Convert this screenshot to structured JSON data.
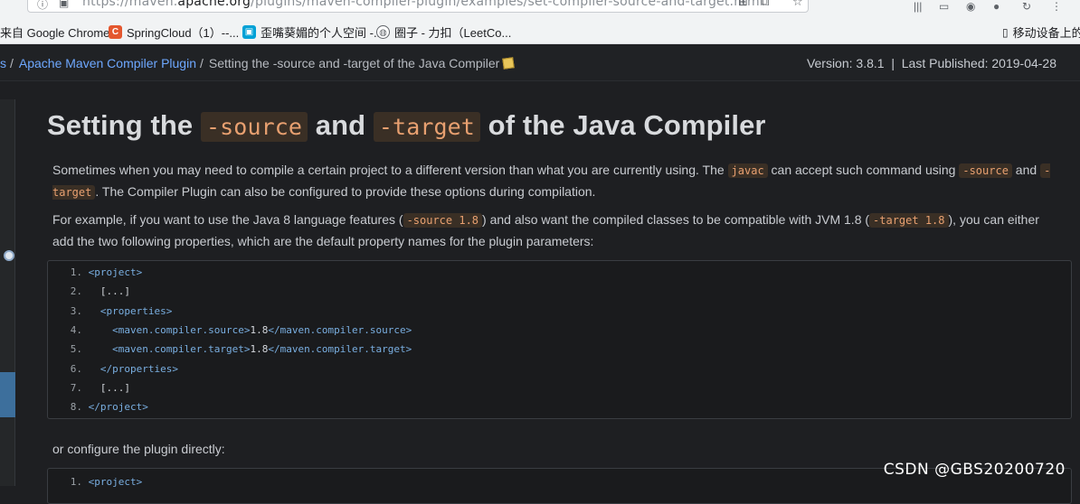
{
  "browser": {
    "url_prefix": "https://maven.",
    "url_host": "apache.org",
    "url_path": "/plugins/maven-compiler-plugin/examples/set-compiler-source-and-target.html",
    "bookmarks": [
      {
        "label": "来自 Google Chrome",
        "icon": "none"
      },
      {
        "label": "SpringCloud（1）--...",
        "icon": "c-logo-icon",
        "color": "#e4572e"
      },
      {
        "label": "歪嘴葵媚的个人空间 -...",
        "icon": "tv-icon",
        "color": "#00a1d6"
      },
      {
        "label": "圈子 - 力扣（LeetCo...",
        "icon": "globe-icon",
        "color": "#5f6368"
      }
    ],
    "mobile_bookmarks": "移动设备上的书"
  },
  "header": {
    "crumb_prev": "s",
    "crumb_plugin": "Apache Maven Compiler Plugin",
    "crumb_current": "Setting the -source and -target of the Java Compiler",
    "version": "Version: 3.8.1",
    "divider": "|",
    "published": "Last Published: 2019-04-28"
  },
  "article": {
    "title_pre": "Setting the ",
    "title_code1": "-source",
    "title_mid": " and ",
    "title_code2": "-target",
    "title_post": " of the Java Compiler",
    "p1_a": "Sometimes when you may need to compile a certain project to a different version than what you are currently using. The ",
    "p1_code1": "javac",
    "p1_b": " can accept such command using ",
    "p1_code2": "-source",
    "p1_c": " and ",
    "p1_code3": "-target",
    "p1_d": ". The Compiler Plugin can also be configured to provide these options during compilation.",
    "p2_a": "For example, if you want to use the Java 8 language features (",
    "p2_code1": "-source 1.8",
    "p2_b": ") and also want the compiled classes to be compatible with JVM 1.8 (",
    "p2_code2": "-target 1.8",
    "p2_c": "), you can either add the two following properties, which are the default property names for the plugin parameters:",
    "code1": [
      {
        "n": "1.",
        "indent": "",
        "t1": "<project>",
        "v": "",
        "t2": ""
      },
      {
        "n": "2.",
        "indent": "  ",
        "t1": "",
        "v": "[...]",
        "t2": ""
      },
      {
        "n": "3.",
        "indent": "  ",
        "t1": "<properties>",
        "v": "",
        "t2": ""
      },
      {
        "n": "4.",
        "indent": "    ",
        "t1": "<maven.compiler.source>",
        "v": "1.8",
        "t2": "</maven.compiler.source>"
      },
      {
        "n": "5.",
        "indent": "    ",
        "t1": "<maven.compiler.target>",
        "v": "1.8",
        "t2": "</maven.compiler.target>"
      },
      {
        "n": "6.",
        "indent": "  ",
        "t1": "</properties>",
        "v": "",
        "t2": ""
      },
      {
        "n": "7.",
        "indent": "  ",
        "t1": "",
        "v": "[...]",
        "t2": ""
      },
      {
        "n": "8.",
        "indent": "",
        "t1": "</project>",
        "v": "",
        "t2": ""
      }
    ],
    "p3": "or configure the plugin directly:",
    "code2_first": {
      "n": "1.",
      "t1": "<project>"
    }
  },
  "watermark": "CSDN @GBS20200720"
}
